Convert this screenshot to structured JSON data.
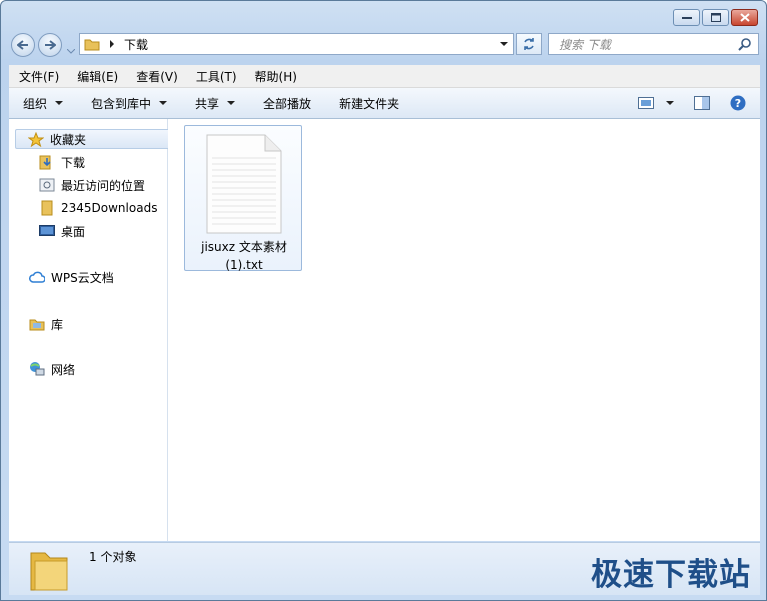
{
  "address": {
    "path": "下载"
  },
  "search": {
    "placeholder": "搜索 下载"
  },
  "menu": {
    "items": [
      "文件(F)",
      "编辑(E)",
      "查看(V)",
      "工具(T)",
      "帮助(H)"
    ]
  },
  "toolbar": {
    "organize": "组织",
    "include": "包含到库中",
    "share": "共享",
    "play_all": "全部播放",
    "new_folder": "新建文件夹"
  },
  "sidebar": {
    "favorites": "收藏夹",
    "items": [
      "下载",
      "最近访问的位置",
      "2345Downloads",
      "桌面"
    ],
    "wps": "WPS云文档",
    "library": "库",
    "network": "网络"
  },
  "files": [
    {
      "name_line1": "jisuxz 文本素材",
      "name_line2": "(1).txt"
    }
  ],
  "status": {
    "count": "1 个对象"
  },
  "watermark": "极速下载站"
}
